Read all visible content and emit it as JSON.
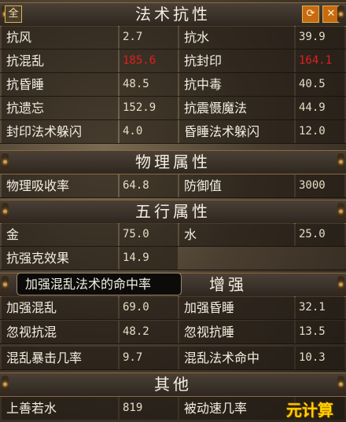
{
  "header_buttons": {
    "quan": "全",
    "refresh_icon": "refresh-icon",
    "close_icon": "close-icon"
  },
  "sections": {
    "resist": {
      "title": "法术抗性",
      "rows": [
        {
          "l1": "抗风",
          "v1": "2.7",
          "l2": "抗水",
          "v2": "39.9"
        },
        {
          "l1": "抗混乱",
          "v1": "185.6",
          "l2": "抗封印",
          "v2": "164.1"
        },
        {
          "l1": "抗昏睡",
          "v1": "48.5",
          "l2": "抗中毒",
          "v2": "40.5"
        },
        {
          "l1": "抗遗忘",
          "v1": "152.9",
          "l2": "抗震慑魔法",
          "v2": "44.9"
        },
        {
          "l1": "封印法术躲闪",
          "v1": "4.0",
          "l2": "昏睡法术躲闪",
          "v2": "12.0"
        }
      ]
    },
    "physical": {
      "title": "物理属性",
      "rows": [
        {
          "l1": "物理吸收率",
          "v1": "64.8",
          "l2": "防御值",
          "v2": "3000"
        }
      ]
    },
    "wuxing": {
      "title": "五行属性",
      "rows": [
        {
          "l1": "金",
          "v1": "75.0",
          "l2": "水",
          "v2": "25.0"
        },
        {
          "l1": "抗强克效果",
          "v1": "14.9",
          "l2": "",
          "v2": ""
        }
      ]
    },
    "enhance": {
      "title": "增强",
      "rows": [
        {
          "l1": "加强混乱",
          "v1": "69.0",
          "l2": "加强昏睡",
          "v2": "32.1"
        },
        {
          "l1": "忽视抗混",
          "v1": "48.2",
          "l2": "忽视抗睡",
          "v2": "13.5"
        },
        {
          "l1": "混乱暴击几率",
          "v1": "9.7",
          "l2": "混乱法术命中",
          "v2": "10.3"
        }
      ]
    },
    "other": {
      "title": "其他",
      "rows": [
        {
          "l1": "上善若水",
          "v1": "819",
          "l2": "被动速几率",
          "v2": ""
        }
      ]
    }
  },
  "tooltip": "加强混乱法术的命中率",
  "watermark": "元计算",
  "colors": {
    "highlight_red": "#e21e1e",
    "accent_orange": "#c86a10"
  }
}
